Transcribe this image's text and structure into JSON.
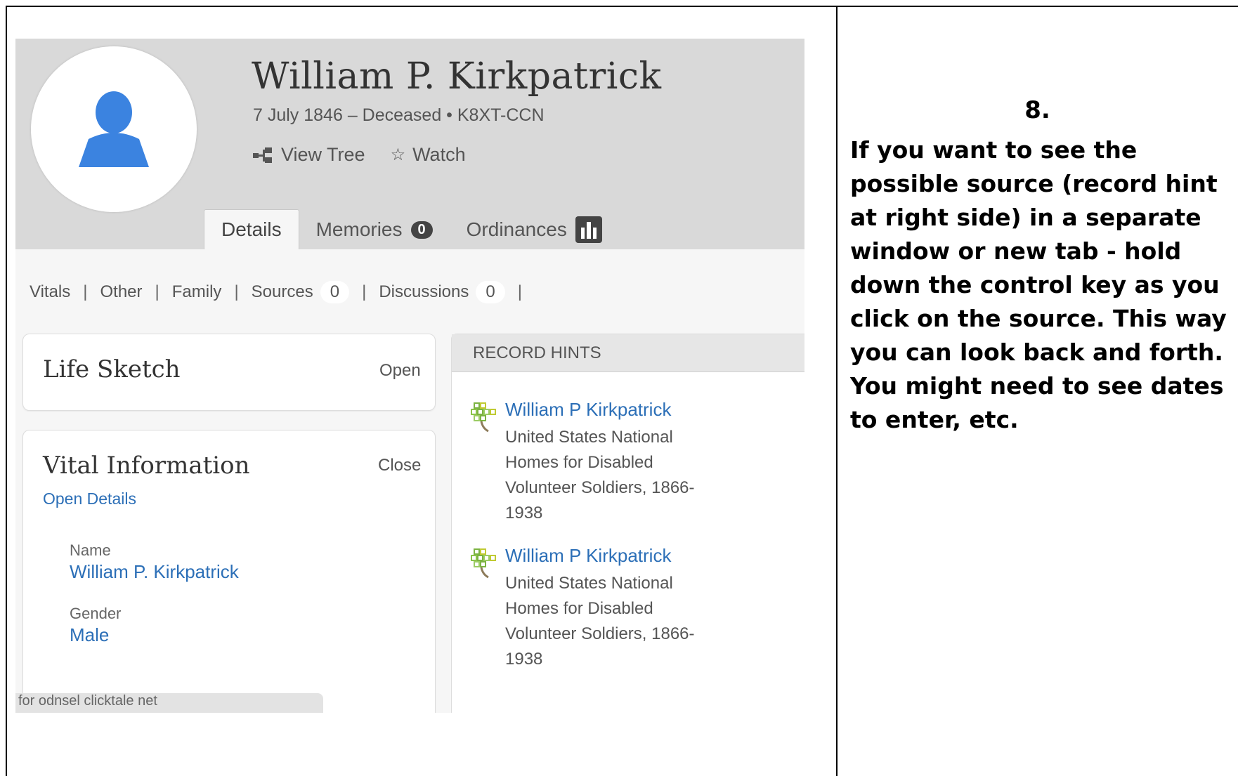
{
  "profile": {
    "name": "William P. Kirkpatrick",
    "dates": "7 July 1846 – Deceased • K8XT-CCN",
    "view_tree": "View Tree",
    "watch": "Watch"
  },
  "tabs": {
    "details": "Details",
    "memories": "Memories",
    "memories_count": "0",
    "ordinances": "Ordinances"
  },
  "subnav": {
    "vitals": "Vitals",
    "other": "Other",
    "family": "Family",
    "sources": "Sources",
    "sources_count": "0",
    "discussions": "Discussions",
    "discussions_count": "0",
    "separator": "|"
  },
  "life_sketch": {
    "title": "Life Sketch",
    "action": "Open"
  },
  "vital_info": {
    "title": "Vital Information",
    "action": "Close",
    "open_details": "Open Details",
    "name_label": "Name",
    "name_value": "William P. Kirkpatrick",
    "gender_label": "Gender",
    "gender_value": "Male"
  },
  "record_hints": {
    "heading": "RECORD HINTS",
    "items": [
      {
        "title": "William P Kirkpatrick",
        "desc": "United States National Homes for Disabled Volunteer Soldiers, 1866-1938"
      },
      {
        "title": "William P Kirkpatrick",
        "desc": "United States National Homes for Disabled Volunteer Soldiers, 1866-1938"
      }
    ]
  },
  "tooltip": "for odnsel clicktale net",
  "instructions": {
    "step": "8.",
    "text": "If you want to see the possible source (record hint at right side) in a separate window or new tab - hold down the control key as you click on the source. This way you can look back and forth. You might need to see dates to enter, etc."
  },
  "icons": [
    "person-silhouette-icon",
    "tree-view-icon",
    "star-outline-icon",
    "temple-icon",
    "record-tree-icon"
  ],
  "colors": {
    "link": "#2c6fb7",
    "header_bg": "#d9d9d9",
    "avatar_blue": "#3b83e0"
  }
}
